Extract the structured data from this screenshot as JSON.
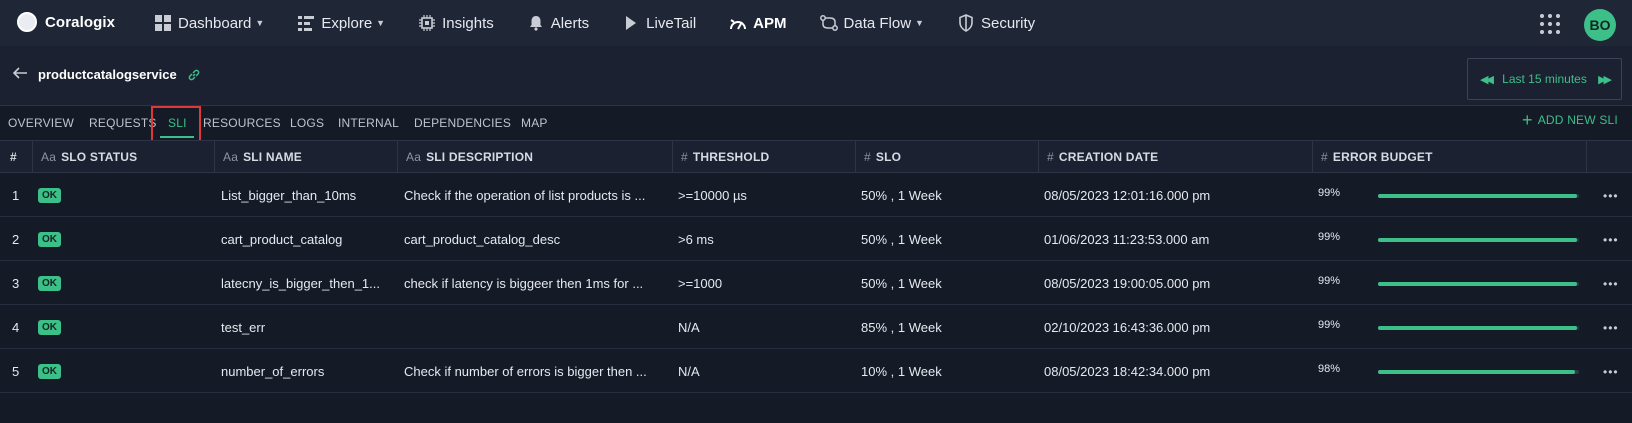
{
  "brand": {
    "name": "Coralogix"
  },
  "nav": [
    {
      "label": "Dashboard",
      "icon": "grid-icon",
      "dropdown": true,
      "active": false
    },
    {
      "label": "Explore",
      "icon": "explore-icon",
      "dropdown": true,
      "active": false
    },
    {
      "label": "Insights",
      "icon": "chip-icon",
      "dropdown": false,
      "active": false
    },
    {
      "label": "Alerts",
      "icon": "bell-icon",
      "dropdown": false,
      "active": false
    },
    {
      "label": "LiveTail",
      "icon": "play-icon",
      "dropdown": false,
      "active": false
    },
    {
      "label": "APM",
      "icon": "gauge-icon",
      "dropdown": false,
      "active": true
    },
    {
      "label": "Data Flow",
      "icon": "flow-icon",
      "dropdown": true,
      "active": false
    },
    {
      "label": "Security",
      "icon": "shield-icon",
      "dropdown": false,
      "active": false
    }
  ],
  "user": {
    "initials": "BO"
  },
  "service": {
    "name": "productcatalogservice"
  },
  "time_picker": {
    "label": "Last 15 minutes"
  },
  "tabs": [
    {
      "label": "OVERVIEW",
      "active": false
    },
    {
      "label": "REQUESTS",
      "active": false
    },
    {
      "label": "SLI",
      "active": true
    },
    {
      "label": "RESOURCES",
      "active": false
    },
    {
      "label": "LOGS",
      "active": false
    },
    {
      "label": "INTERNAL",
      "active": false
    },
    {
      "label": "DEPENDENCIES",
      "active": false
    },
    {
      "label": "MAP",
      "active": false
    }
  ],
  "add_sli_label": "ADD NEW SLI",
  "table": {
    "columns": [
      {
        "label": "#",
        "type_icon": ""
      },
      {
        "label": "SLO STATUS",
        "type_icon": "Aa"
      },
      {
        "label": "SLI NAME",
        "type_icon": "Aa"
      },
      {
        "label": "SLI DESCRIPTION",
        "type_icon": "Aa"
      },
      {
        "label": "THRESHOLD",
        "type_icon": "#"
      },
      {
        "label": "SLO",
        "type_icon": "#"
      },
      {
        "label": "CREATION DATE",
        "type_icon": "#"
      },
      {
        "label": "ERROR BUDGET",
        "type_icon": "#"
      }
    ],
    "rows": [
      {
        "index": "1",
        "status": "OK",
        "name": "List_bigger_than_10ms",
        "description": "Check if the operation of list products is ...",
        "threshold": ">=10000 µs",
        "slo": "50% , 1 Week",
        "created": "08/05/2023 12:01:16.000 pm",
        "budget_label": "99%",
        "budget": 0.99
      },
      {
        "index": "2",
        "status": "OK",
        "name": "cart_product_catalog",
        "description": "cart_product_catalog_desc",
        "threshold": ">6 ms",
        "slo": "50% , 1 Week",
        "created": "01/06/2023 11:23:53.000 am",
        "budget_label": "99%",
        "budget": 0.99
      },
      {
        "index": "3",
        "status": "OK",
        "name": "latecny_is_bigger_then_1...",
        "description": "check if latency is biggeer then 1ms for ...",
        "threshold": ">=1000",
        "slo": "50% , 1 Week",
        "created": "08/05/2023 19:00:05.000 pm",
        "budget_label": "99%",
        "budget": 0.99
      },
      {
        "index": "4",
        "status": "OK",
        "name": "test_err",
        "description": "",
        "threshold": "N/A",
        "slo": "85% , 1 Week",
        "created": "02/10/2023 16:43:36.000 pm",
        "budget_label": "99%",
        "budget": 0.99
      },
      {
        "index": "5",
        "status": "OK",
        "name": "number_of_errors",
        "description": "Check if number of errors is bigger then ...",
        "threshold": "N/A",
        "slo": "10% , 1 Week",
        "created": "08/05/2023 18:42:34.000 pm",
        "budget_label": "98%",
        "budget": 0.98
      }
    ]
  },
  "colors": {
    "accent": "#3dbf8a",
    "highlight": "#e0383a",
    "background": "#141a26"
  }
}
